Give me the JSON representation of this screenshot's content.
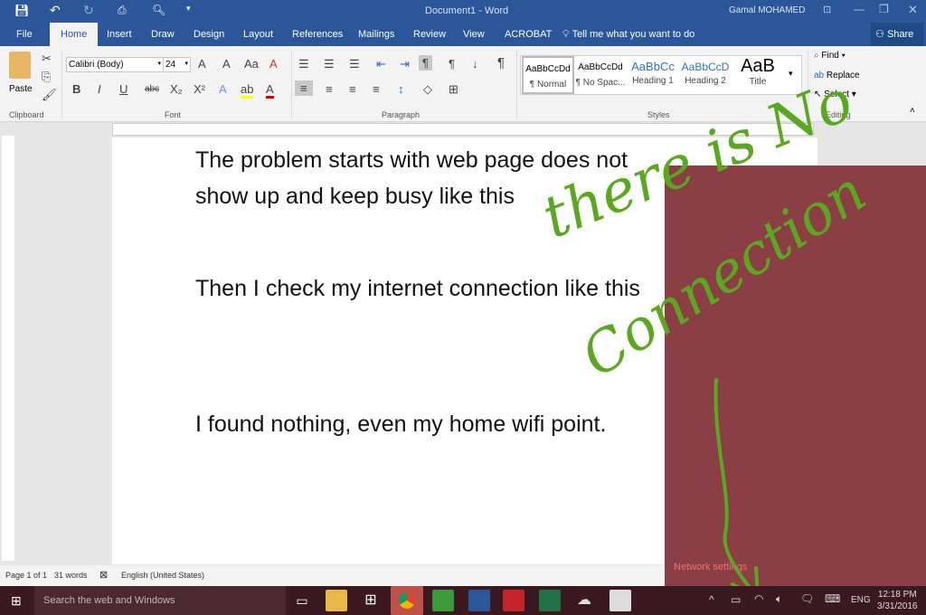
{
  "window": {
    "title": "Document1 - Word",
    "user": "Gamal MOHAMED"
  },
  "tabs": [
    "File",
    "Home",
    "Insert",
    "Draw",
    "Design",
    "Layout",
    "References",
    "Mailings",
    "Review",
    "View",
    "ACROBAT"
  ],
  "tell_me": "Tell me what you want to do",
  "share": "Share",
  "clipboard": {
    "paste": "Paste",
    "group": "Clipboard"
  },
  "font": {
    "name": "Calibri (Body)",
    "size": "24",
    "group": "Font"
  },
  "paragraph": {
    "group": "Paragraph"
  },
  "styles": {
    "group": "Styles",
    "items": [
      {
        "preview": "AaBbCcDd",
        "name": "¶ Normal"
      },
      {
        "preview": "AaBbCcDd",
        "name": "¶ No Spac..."
      },
      {
        "preview": "AaBbCc",
        "name": "Heading 1"
      },
      {
        "preview": "AaBbCcD",
        "name": "Heading 2"
      },
      {
        "preview": "AaB",
        "name": "Title"
      }
    ]
  },
  "editing": {
    "group": "Editing",
    "find": "Find",
    "replace": "Replace",
    "select": "Select"
  },
  "document": {
    "lines": [
      "The problem starts with web page does not",
      "show up and keep busy like this",
      "Then I check my internet connection like this",
      "I found nothing, even my home wifi point."
    ]
  },
  "status": {
    "page": "Page 1 of 1",
    "words": "31 words",
    "language": "English (United States)"
  },
  "network": {
    "settings": "Network settings"
  },
  "annotation": {
    "line1": "there is No",
    "line2": "Connection"
  },
  "taskbar": {
    "search": "Search the web and Windows",
    "lang": "ENG",
    "time": "12:18 PM",
    "date": "3/31/2016"
  },
  "colors": {
    "word_blue": "#2b579a",
    "flyout": "#8b3e44",
    "ink": "#5aa820"
  }
}
